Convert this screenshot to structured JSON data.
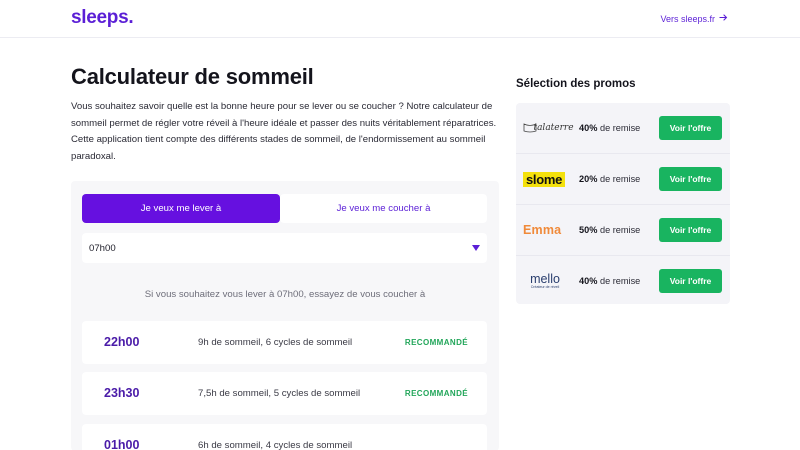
{
  "header": {
    "logo": "sleeps.",
    "link_label": "Vers sleeps.fr",
    "link_icon": "arrow-right-icon",
    "accent": "#5b1fd6"
  },
  "main": {
    "title": "Calculateur de sommeil",
    "intro": "Vous souhaitez savoir quelle est la bonne heure pour se lever ou se coucher ? Notre calculateur de sommeil permet de régler votre réveil à l'heure idéale et passer des nuits véritablement réparatrices. Cette application tient compte des différents stades de sommeil, de l'endormissement au sommeil paradoxal.",
    "tabs": [
      {
        "label": "Je veux me lever à",
        "active": true
      },
      {
        "label": "Je veux me coucher à",
        "active": false
      }
    ],
    "select_value": "07h00",
    "hint": "Si vous souhaitez vous lever à 07h00, essayez de vous coucher à",
    "results": [
      {
        "time": "22h00",
        "desc": "9h de sommeil, 6 cycles de sommeil",
        "badge": "RECOMMANDÉ"
      },
      {
        "time": "23h30",
        "desc": "7,5h de sommeil, 5 cycles de sommeil",
        "badge": "RECOMMANDÉ"
      },
      {
        "time": "01h00",
        "desc": "6h de sommeil, 4 cycles de sommeil",
        "badge": ""
      }
    ],
    "colors": {
      "active_tab": "#6610e0",
      "time": "#4a1ba8",
      "badge": "#22a65a"
    }
  },
  "sidebar": {
    "title": "Sélection des promos",
    "promos": [
      {
        "brand": "talaterre",
        "brand_sub": "",
        "discount": "40%",
        "suffix": "de remise",
        "button": "Voir l'offre"
      },
      {
        "brand": "slome",
        "discount": "20%",
        "suffix": "de remise",
        "button": "Voir l'offre"
      },
      {
        "brand": "Emma",
        "discount": "50%",
        "suffix": "de remise",
        "button": "Voir l'offre"
      },
      {
        "brand": "mello",
        "brand_sub": "Créateur de réveil",
        "discount": "40%",
        "suffix": "de remise",
        "button": "Voir l'offre"
      }
    ],
    "button_color": "#19b460"
  }
}
